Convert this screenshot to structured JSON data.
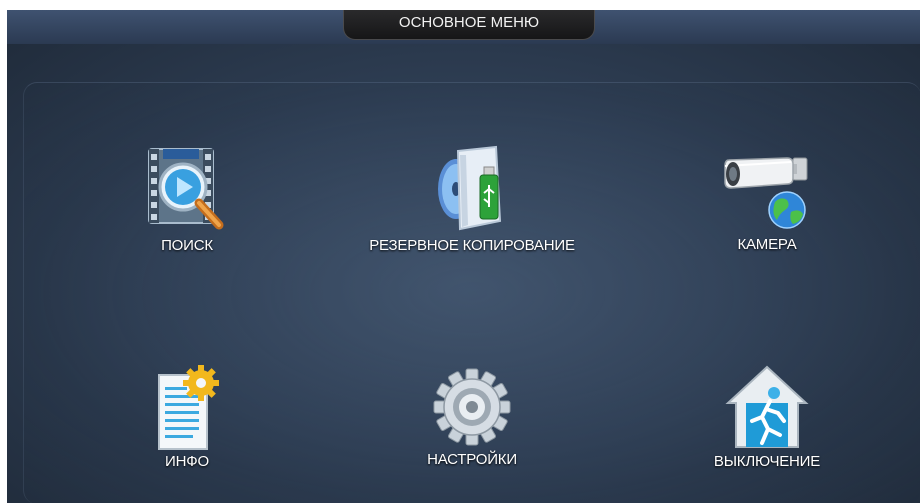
{
  "header": {
    "title": "ОСНОВНОЕ МЕНЮ"
  },
  "menu": {
    "search": {
      "label": "ПОИСК",
      "icon": "film-magnifier-icon"
    },
    "backup": {
      "label": "РЕЗЕРВНОЕ КОПИРОВАНИЕ",
      "icon": "disc-usb-icon"
    },
    "camera": {
      "label": "КАМЕРА",
      "icon": "camera-globe-icon"
    },
    "info": {
      "label": "ИНФО",
      "icon": "document-gear-icon"
    },
    "settings": {
      "label": "НАСТРОЙКИ",
      "icon": "gear-icon"
    },
    "shutdown": {
      "label": "ВЫКЛЮЧЕНИЕ",
      "icon": "house-exit-icon"
    }
  },
  "colors": {
    "background": "#2f3f55",
    "header": "#3f5270",
    "title_tab": "#1c1c1d",
    "text": "#ffffff"
  }
}
